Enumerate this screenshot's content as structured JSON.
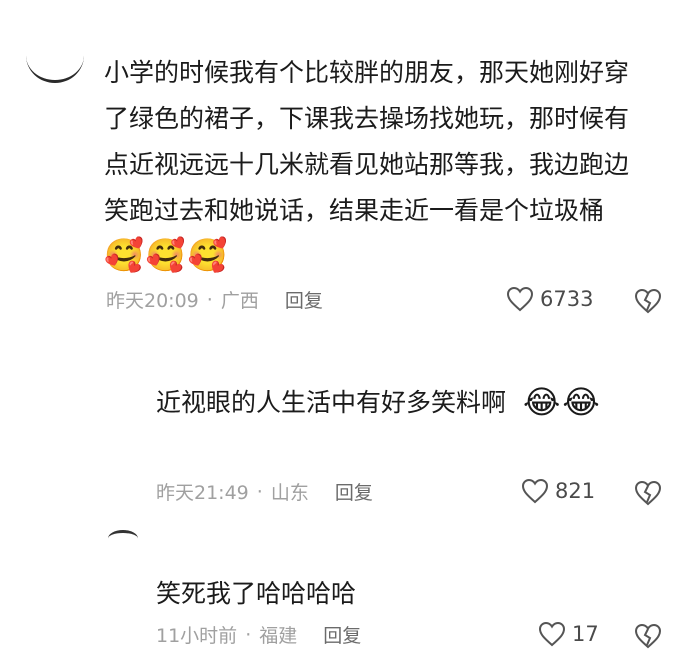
{
  "comments": [
    {
      "lines": [
        "小学的时候我有个比较胖的朋友，那天她刚好穿",
        "了绿色的裙子，下课我去操场找她玩，那时候有",
        "点近视远远十几米就看见她站那等我，我边跑边",
        "笑跑过去和她说话，结果走近一看是个垃圾桶"
      ],
      "emojis": [
        "🥰",
        "🥰",
        "🥰"
      ],
      "time": "昨天20:09",
      "location": "广西",
      "reply_label": "回复",
      "likes": "6733"
    },
    {
      "text": "近视眼的人生活中有好多笑料啊",
      "emojis": [
        "😂",
        "😂"
      ],
      "time": "昨天21:49",
      "location": "山东",
      "reply_label": "回复",
      "likes": "821"
    },
    {
      "text": "笑死我了哈哈哈哈",
      "time": "11小时前",
      "location": "福建",
      "reply_label": "回复",
      "likes": "17"
    }
  ],
  "separator": "·",
  "icons": {
    "like": "heart-outline-icon",
    "dislike": "broken-heart-icon"
  },
  "colors": {
    "text": "#1b1b1b",
    "meta": "#a0a0a0",
    "reply": "#6b6b6b",
    "icon": "#555555"
  }
}
